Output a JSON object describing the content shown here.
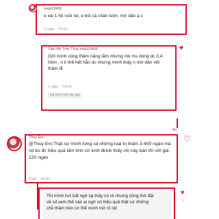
{
  "comments": [
    {
      "username": "mayi23456",
      "text": "e xài 1 hủ ruồi nè, e bôi cả chân luôn. mờ dần ạ c",
      "time": "1 ngày",
      "reply": "Trả lời"
    },
    {
      "username": "Tâm Mỹ Tran Thị",
      "reply_to": "mayi23456",
      "text": "Gởi mình cũng thâm nặng lắm nhưng mk ms dùng dc 3,4 hôm , n k thể hết hẳn dc nhưng mình thấy n mờ dần vết thâm đi",
      "time": "1 ngày",
      "reply": "Trả lời",
      "liked_by_author": "Đã thích bởi tác giả"
    },
    {
      "username": "Thùy Em",
      "text": "@Thùy Em:Thật sự mình từng sd những loại trị thâm 3-400 ngàn mà nó ko đc hiệu quả lắm tình cờ lướt tiktok thấy chị này bán thì với giá 120 ngàn",
      "time": "9 giờ",
      "reply": "Trả lời"
    },
    {
      "text": "Thì mình hơi bất ngờ tại thấy nó rẻ nhưng cũng thử đặt về sd xem thế nào ai ngờ nó hiệu quả thật sự những chỗ thâm trên cơ thể mình mờ rõ rệt"
    }
  ],
  "decor": {
    "heart_count": "1",
    "collapse_label": "Ẩn",
    "accent": "#d8102e"
  }
}
